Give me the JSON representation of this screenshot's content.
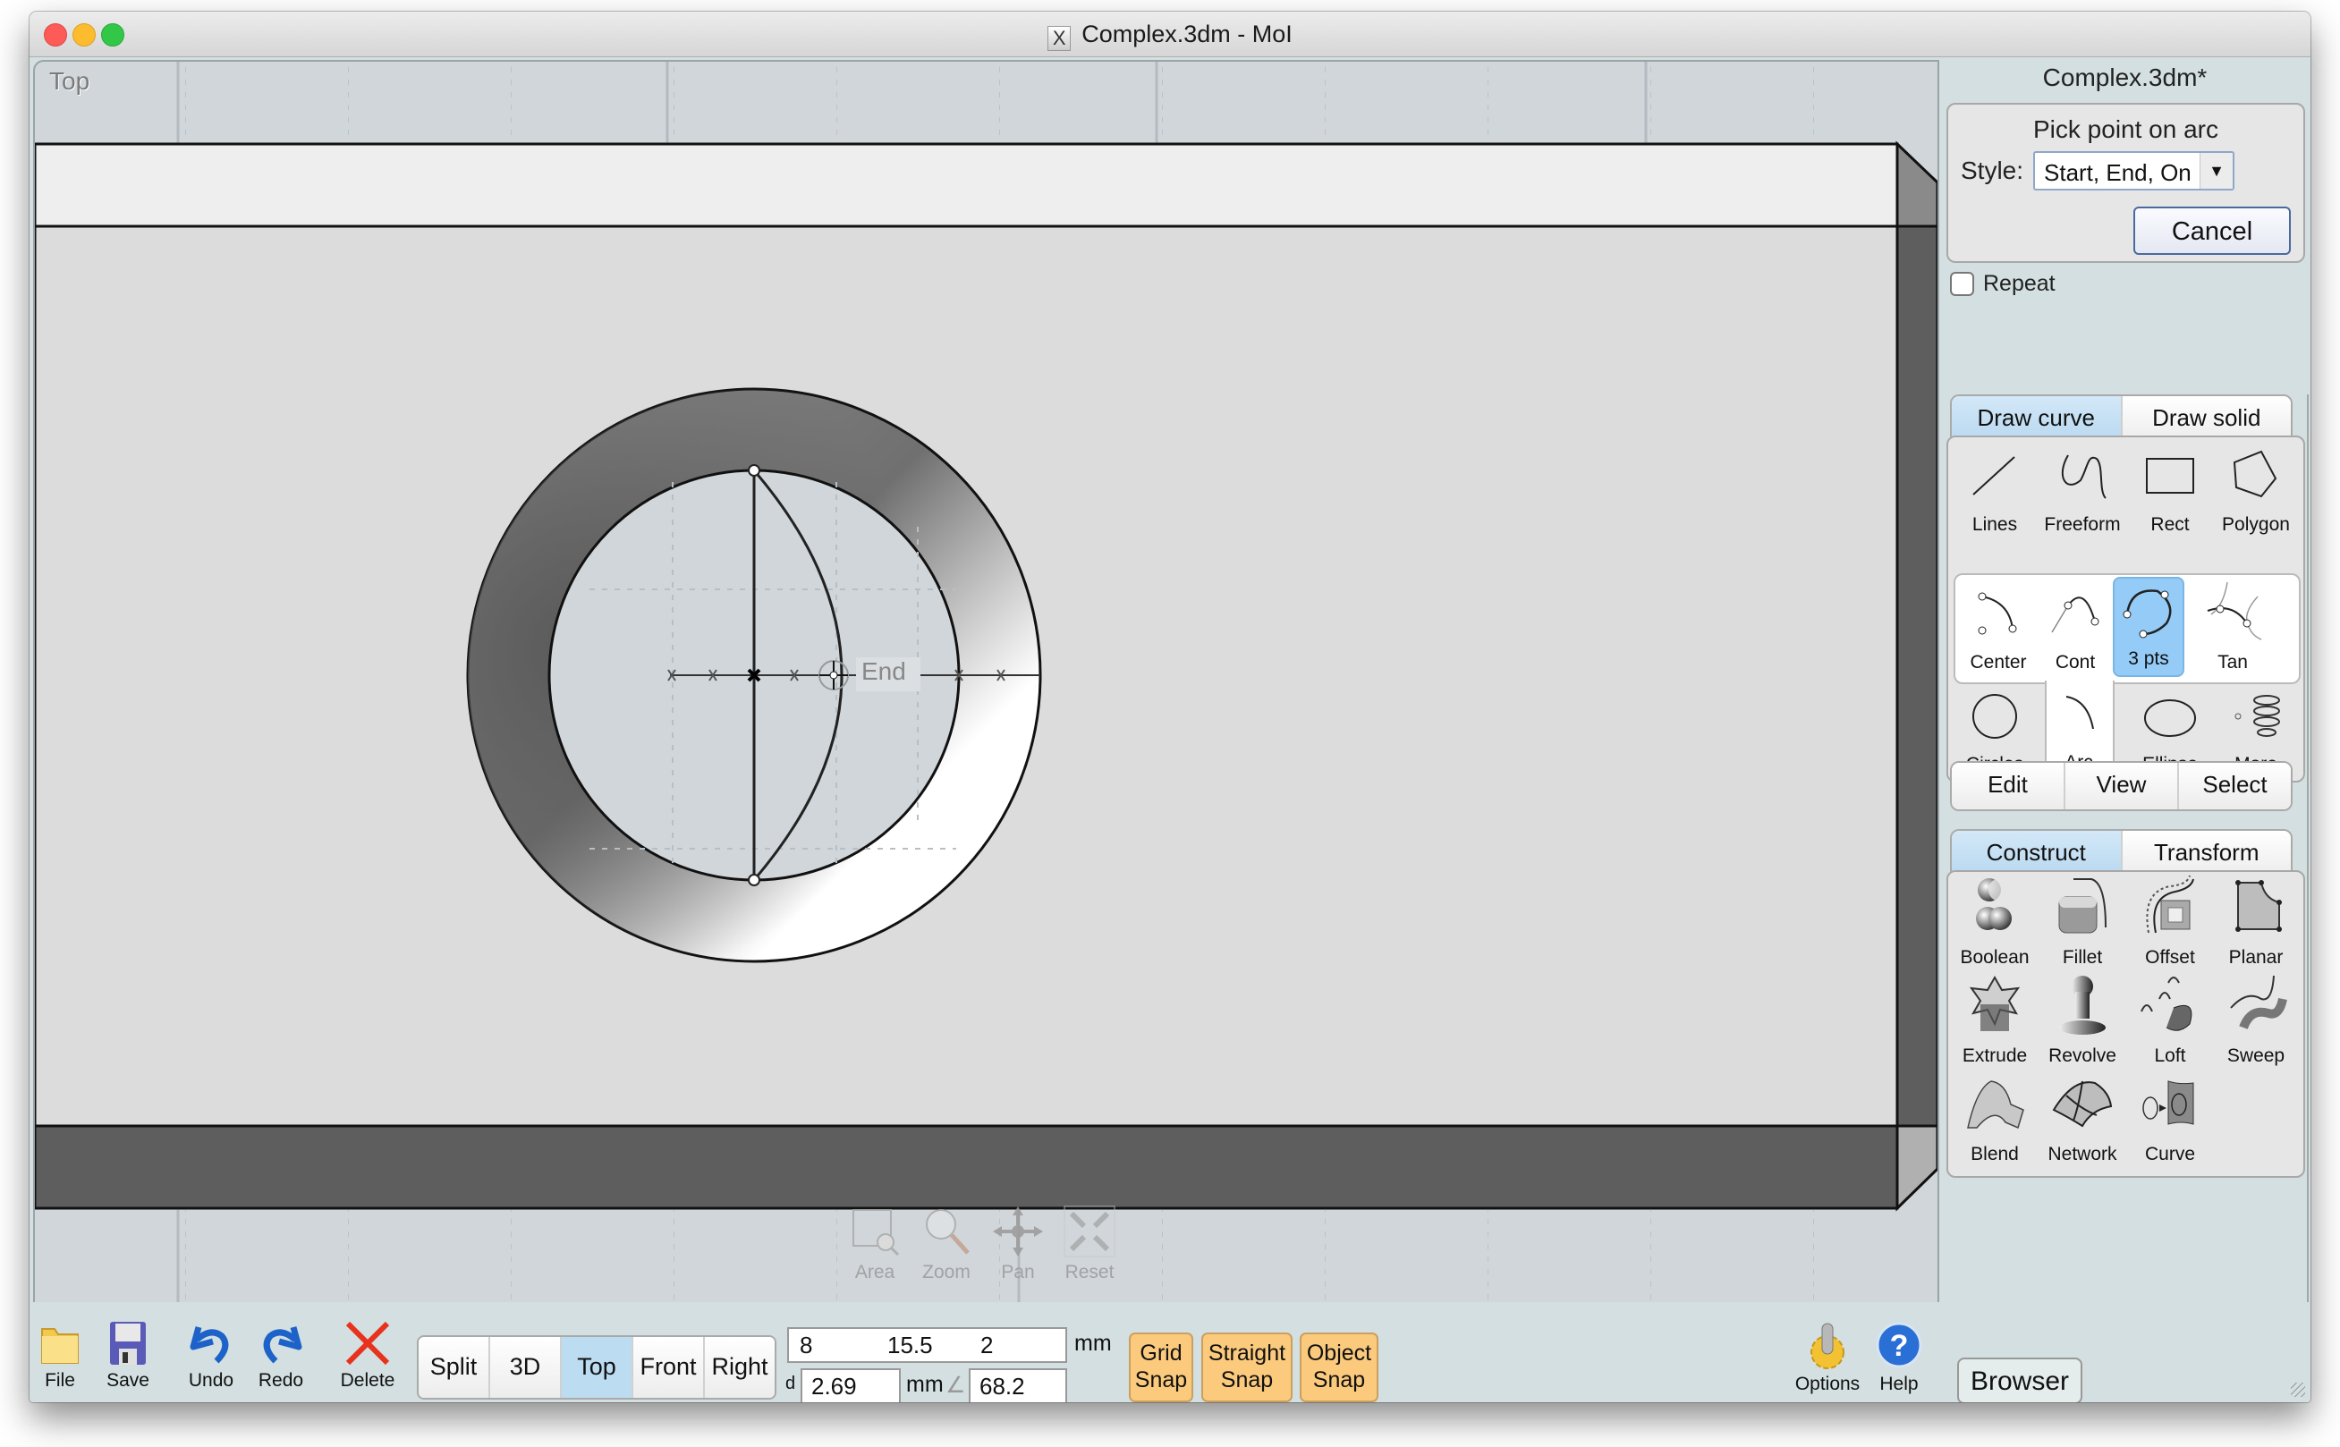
{
  "window": {
    "title": "Complex.3dm - MoI",
    "app_icon": "x11-icon",
    "controls": [
      "close",
      "minimize",
      "maximize"
    ]
  },
  "viewport": {
    "label": "Top",
    "snap_tooltip": "End",
    "nav_tools": [
      {
        "label": "Area",
        "icon": "zoom-area-icon"
      },
      {
        "label": "Zoom",
        "icon": "magnifier-icon"
      },
      {
        "label": "Pan",
        "icon": "pan-arrows-icon"
      },
      {
        "label": "Reset",
        "icon": "reset-view-icon"
      }
    ]
  },
  "panel": {
    "document_name": "Complex.3dm*",
    "prompt": "Pick point on arc",
    "style_label": "Style:",
    "style_value": "Start, End, On",
    "cancel_label": "Cancel",
    "repeat_label": "Repeat",
    "repeat_checked": false,
    "draw_tabs": [
      {
        "label": "Draw curve",
        "active": true
      },
      {
        "label": "Draw solid",
        "active": false
      }
    ],
    "draw_tools": [
      {
        "label": "Lines",
        "icon": "line-icon"
      },
      {
        "label": "Freeform",
        "icon": "freeform-curve-icon"
      },
      {
        "label": "Rect",
        "icon": "rectangle-icon"
      },
      {
        "label": "Polygon",
        "icon": "polygon-icon"
      }
    ],
    "arc_tools": [
      {
        "label": "Center",
        "icon": "arc-center-icon",
        "selected": false
      },
      {
        "label": "Cont",
        "icon": "arc-continue-icon",
        "selected": false
      },
      {
        "label": "3 pts",
        "icon": "arc-3pts-icon",
        "selected": true
      },
      {
        "label": "Tan",
        "icon": "arc-tangent-icon",
        "selected": false
      }
    ],
    "shape_tools": [
      {
        "label": "Circles",
        "icon": "circle-icon"
      },
      {
        "label": "Arc",
        "icon": "arc-icon",
        "expanded": true
      },
      {
        "label": "Ellipse",
        "icon": "ellipse-icon"
      },
      {
        "label": "More",
        "icon": "helix-icon"
      }
    ],
    "edit_tabs": [
      {
        "label": "Edit"
      },
      {
        "label": "View"
      },
      {
        "label": "Select"
      }
    ],
    "construct_tabs": [
      {
        "label": "Construct",
        "active": true
      },
      {
        "label": "Transform",
        "active": false
      }
    ],
    "construct_tools": [
      {
        "label": "Boolean",
        "icon": "boolean-icon"
      },
      {
        "label": "Fillet",
        "icon": "fillet-icon"
      },
      {
        "label": "Offset",
        "icon": "offset-icon"
      },
      {
        "label": "Planar",
        "icon": "planar-icon"
      },
      {
        "label": "Extrude",
        "icon": "extrude-icon"
      },
      {
        "label": "Revolve",
        "icon": "revolve-icon"
      },
      {
        "label": "Loft",
        "icon": "loft-icon"
      },
      {
        "label": "Sweep",
        "icon": "sweep-icon"
      },
      {
        "label": "Blend",
        "icon": "blend-icon"
      },
      {
        "label": "Network",
        "icon": "network-icon"
      },
      {
        "label": "Curve",
        "icon": "curve-project-icon"
      }
    ]
  },
  "bottombar": {
    "buttons": [
      {
        "label": "File",
        "icon": "folder-icon"
      },
      {
        "label": "Save",
        "icon": "floppy-disk-icon"
      },
      {
        "label": "Undo",
        "icon": "undo-icon"
      },
      {
        "label": "Redo",
        "icon": "redo-icon"
      },
      {
        "label": "Delete",
        "icon": "delete-x-icon"
      }
    ],
    "view_tabs": [
      {
        "label": "Split",
        "active": false
      },
      {
        "label": "3D",
        "active": false
      },
      {
        "label": "Top",
        "active": true
      },
      {
        "label": "Front",
        "active": false
      },
      {
        "label": "Right",
        "active": false
      }
    ],
    "coords": {
      "x": "8",
      "y": "15.5",
      "z": "2",
      "unit": "mm"
    },
    "distance": {
      "prefix": "d",
      "value": "2.69",
      "unit": "mm"
    },
    "angle": {
      "symbol": "∠",
      "value": "68.2"
    },
    "snaps": [
      {
        "line1": "Grid",
        "line2": "Snap",
        "on": true
      },
      {
        "line1": "Straight",
        "line2": "Snap",
        "on": true
      },
      {
        "line1": "Object",
        "line2": "Snap",
        "on": true
      }
    ],
    "options_label": "Options",
    "help_label": "Help",
    "browser_label": "Browser"
  },
  "colors": {
    "panel_bg": "#d3dfe0",
    "viewport_bg": "#d0d6da",
    "active_tab": "#bcdcf2",
    "selected_tool": "#94ccf7",
    "snap_on": "#fcca7c"
  }
}
